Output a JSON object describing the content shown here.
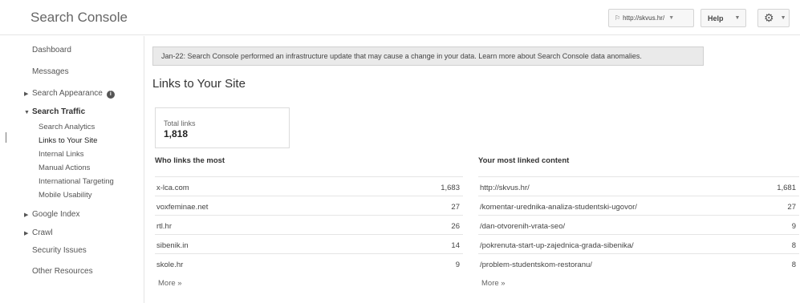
{
  "app": {
    "title": "Search Console"
  },
  "header": {
    "site_select": "http://skvus.hr/",
    "help_label": "Help"
  },
  "sidebar": {
    "items": [
      {
        "label": "Dashboard"
      },
      {
        "label": "Messages"
      },
      {
        "label": "Search Appearance"
      },
      {
        "label": "Search Traffic"
      },
      {
        "label": "Google Index"
      },
      {
        "label": "Crawl"
      },
      {
        "label": "Security Issues"
      },
      {
        "label": "Other Resources"
      }
    ],
    "search_traffic_sub": [
      {
        "label": "Search Analytics"
      },
      {
        "label": "Links to Your Site"
      },
      {
        "label": "Internal Links"
      },
      {
        "label": "Manual Actions"
      },
      {
        "label": "International Targeting"
      },
      {
        "label": "Mobile Usability"
      }
    ]
  },
  "banner": {
    "text": "Jan-22: Search Console performed an infrastructure update that may cause a change in your data. Learn more about Search Console data anomalies."
  },
  "main": {
    "title": "Links to Your Site",
    "total_label": "Total links",
    "total_value": "1,818",
    "who_links": {
      "title": "Who links the most",
      "rows": [
        {
          "name": "x-lca.com",
          "count": "1,683"
        },
        {
          "name": "voxfeminae.net",
          "count": "27"
        },
        {
          "name": "rtl.hr",
          "count": "26"
        },
        {
          "name": "sibenik.in",
          "count": "14"
        },
        {
          "name": "skole.hr",
          "count": "9"
        }
      ],
      "more": "More »"
    },
    "most_linked": {
      "title": "Your most linked content",
      "rows": [
        {
          "name": "http://skvus.hr/",
          "count": "1,681"
        },
        {
          "name": "/komentar-urednika-analiza-studentski-ugovor/",
          "count": "27"
        },
        {
          "name": "/dan-otvorenih-vrata-seo/",
          "count": "9"
        },
        {
          "name": "/pokrenuta-start-up-zajednica-grada-sibenika/",
          "count": "8"
        },
        {
          "name": "/problem-studentskom-restoranu/",
          "count": "8"
        }
      ],
      "more": "More »"
    }
  }
}
